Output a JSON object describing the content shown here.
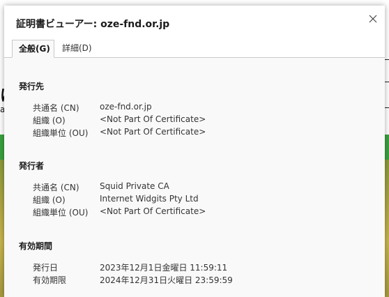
{
  "background": {
    "glyph_left": "a",
    "glyph_top": "け"
  },
  "dialog": {
    "title": "証明書ビューアー: oze-fnd.or.jp",
    "tabs": [
      {
        "label": "全般(G)",
        "active": true
      },
      {
        "label": "詳細(D)",
        "active": false
      }
    ],
    "sections": [
      {
        "heading": "発行先",
        "rows": [
          {
            "label": "共通名 (CN)",
            "value": "oze-fnd.or.jp"
          },
          {
            "label": "組織 (O)",
            "value": "<Not Part Of Certificate>"
          },
          {
            "label": "組織単位 (OU)",
            "value": "<Not Part Of Certificate>"
          }
        ]
      },
      {
        "heading": "発行者",
        "rows": [
          {
            "label": "共通名 (CN)",
            "value": "Squid Private CA"
          },
          {
            "label": "組織 (O)",
            "value": "Internet Widgits Pty Ltd"
          },
          {
            "label": "組織単位 (OU)",
            "value": "<Not Part Of Certificate>"
          }
        ]
      },
      {
        "heading": "有効期間",
        "rows": [
          {
            "label": "発行日",
            "value": "2023年12月1日金曜日 11:59:11"
          },
          {
            "label": "有効期限",
            "value": "2024年12月31日火曜日 23:59:59"
          }
        ]
      }
    ]
  },
  "colors": {
    "background_green": "#3aa23f",
    "panel": "#f9f9f9"
  },
  "icons": {
    "close": "close-icon"
  }
}
